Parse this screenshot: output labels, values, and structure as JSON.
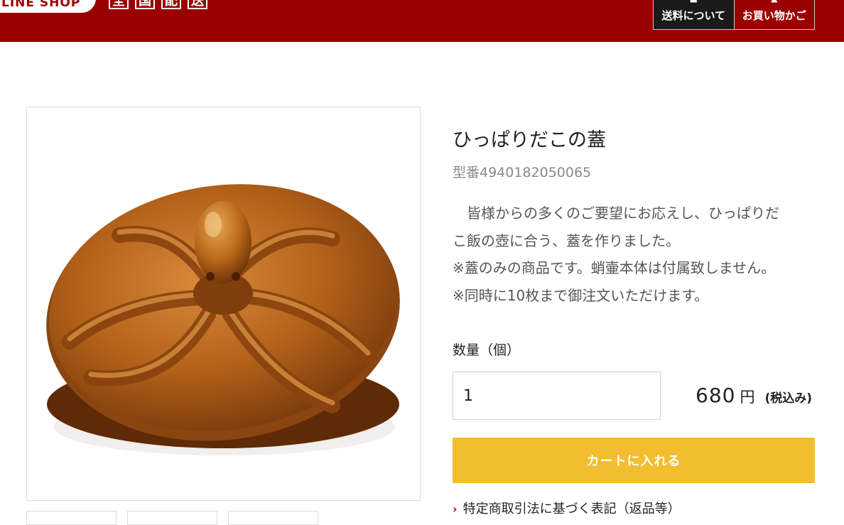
{
  "header": {
    "logo_text": "LINE SHOP",
    "banner_chars": [
      "全",
      "国",
      "配",
      "送"
    ],
    "shipping_label": "送料について",
    "cart_label": "お買い物かご",
    "bg_color": "#9a0000"
  },
  "product": {
    "title": "ひっぱりだこの蓋",
    "model": "型番4940182050065",
    "description": [
      "　皆様からの多くのご要望にお応えし、ひっぱりだ",
      "こ飯の壺に合う、蓋を作りました。",
      "※蓋のみの商品です。蛸壷本体は付属致しません。",
      "※同時に10枚まで御注文いただけます。"
    ],
    "image_icon": "octopus-lid-photo"
  },
  "order": {
    "qty_label": "数量（個）",
    "qty_value": "1",
    "price": "680",
    "currency": "円",
    "tax_note": "(税込み)",
    "add_to_cart": "カートに入れる",
    "button_color": "#f2bd2e"
  },
  "links": {
    "legal": "特定商取引法に基づく表記（返品等）"
  }
}
